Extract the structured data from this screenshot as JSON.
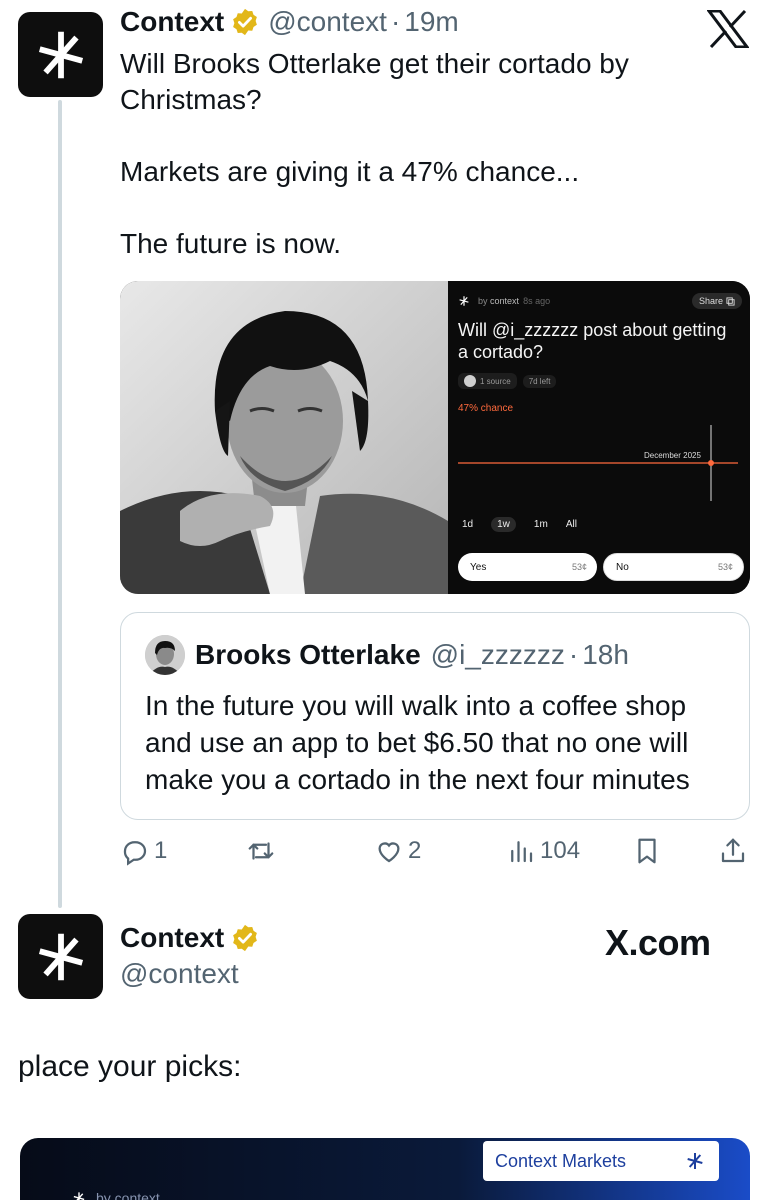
{
  "tweet": {
    "author_name": "Context",
    "author_handle": "@context",
    "separator": "·",
    "time": "19m",
    "lines": [
      "Will Brooks Otterlake get their cortado by Christmas?",
      "Markets are giving it a 47% chance...",
      "The future is now."
    ]
  },
  "market_card": {
    "by_label": "by",
    "by_name": "context",
    "ago": "8s ago",
    "share_label": "Share",
    "question": "Will @i_zzzzzz post about getting a cortado?",
    "sources": "1 source",
    "time_left": "7d left",
    "chance": "47% chance",
    "chart_date_label": "December 2025",
    "ranges": [
      "1d",
      "1w",
      "1m",
      "All"
    ],
    "selected_range": "1w",
    "yes_label": "Yes",
    "yes_price": "53¢",
    "no_label": "No",
    "no_price": "53¢",
    "accent_color": "#ff6a3d"
  },
  "quote": {
    "author_name": "Brooks Otterlake",
    "author_handle": "@i_zzzzzz",
    "separator": "·",
    "time": "18h",
    "text": "In the future you will walk into a coffee shop and use an app to bet $6.50 that no one will make you a cortado in the next four minutes"
  },
  "actions": {
    "replies": "1",
    "likes": "2",
    "views": "104"
  },
  "second": {
    "author_name": "Context",
    "author_handle": "@context",
    "site": "X.com",
    "body": "place your picks:",
    "banner_label": "Context Markets",
    "banner_by": "by context"
  },
  "colors": {
    "text_primary": "#0f1419",
    "text_secondary": "#536471",
    "verified_gold": "#e2b719",
    "border": "#cfd9de"
  }
}
